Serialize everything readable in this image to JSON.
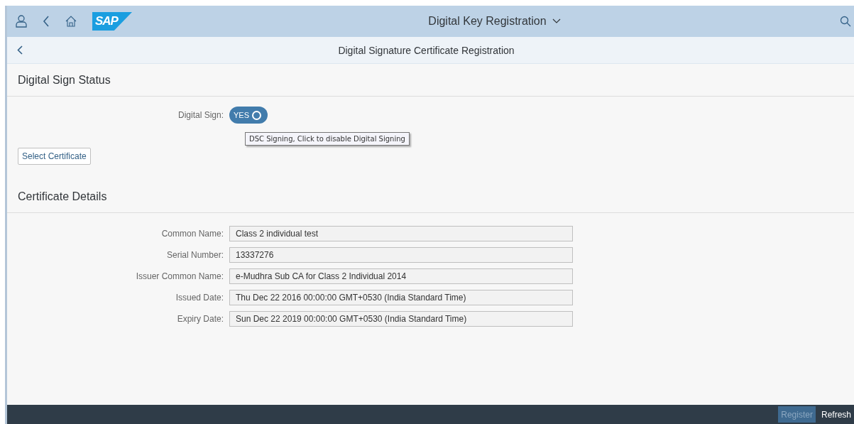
{
  "shell": {
    "title": "Digital Key Registration",
    "logo": "SAP"
  },
  "page": {
    "title": "Digital Signature Certificate Registration"
  },
  "status_section": {
    "title": "Digital Sign Status",
    "toggle": {
      "label": "Digital Sign:",
      "on": true,
      "on_text": "YES",
      "tooltip": "DSC Signing, Click to disable Digital Signing"
    },
    "button": "Select Certificate"
  },
  "details_section": {
    "title": "Certificate Details",
    "fields": [
      {
        "label": "Common Name:",
        "value": "Class 2 individual test"
      },
      {
        "label": "Serial Number:",
        "value": "13337276"
      },
      {
        "label": "Issuer Common Name:",
        "value": "e-Mudhra Sub CA for Class 2 Individual 2014"
      },
      {
        "label": "Issued Date:",
        "value": "Thu Dec 22 2016 00:00:00 GMT+0530 (India Standard Time)"
      },
      {
        "label": "Expiry Date:",
        "value": "Sun Dec 22 2019 00:00:00 GMT+0530 (India Standard Time)"
      }
    ]
  },
  "footer": {
    "buttons": [
      {
        "label": "Register",
        "disabled": true
      },
      {
        "label": "Refresh",
        "disabled": false
      }
    ]
  }
}
